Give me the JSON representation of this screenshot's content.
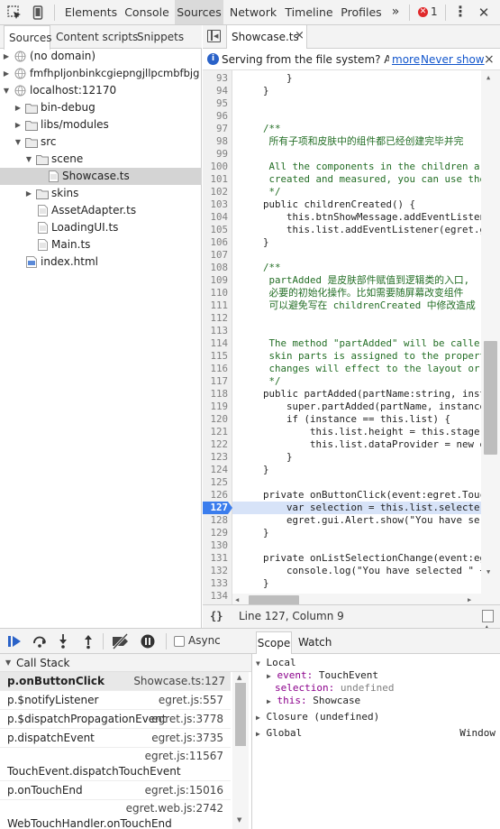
{
  "toolbar": {
    "tabs": [
      "Elements",
      "Console",
      "Sources",
      "Network",
      "Timeline",
      "Profiles"
    ],
    "active_tab": "Sources",
    "more": "»",
    "error_count": "1"
  },
  "navigator": {
    "tabs": [
      "Sources",
      "Content scripts",
      "Snippets"
    ],
    "tree": [
      {
        "label": "(no domain)"
      },
      {
        "label": "fmfhpljonbinkcgiepngjllpcmbfbjg"
      },
      {
        "label": "localhost:12170"
      },
      {
        "label": "bin-debug"
      },
      {
        "label": "libs/modules"
      },
      {
        "label": "src"
      },
      {
        "label": "scene"
      },
      {
        "label": "Showcase.ts"
      },
      {
        "label": "skins"
      },
      {
        "label": "AssetAdapter.ts"
      },
      {
        "label": "LoadingUI.ts"
      },
      {
        "label": "Main.ts"
      },
      {
        "label": "index.html"
      }
    ]
  },
  "editor": {
    "tab": "Showcase.ts",
    "tab_close": "×",
    "info": {
      "text": "Serving from the file system? Add y",
      "more": "more",
      "never_show": "Never show",
      "close": "×"
    },
    "lines": [
      {
        "n": "93",
        "t": "        }"
      },
      {
        "n": "94",
        "t": "    }"
      },
      {
        "n": "95",
        "t": ""
      },
      {
        "n": "96",
        "t": ""
      },
      {
        "n": "97",
        "t": "    /**"
      },
      {
        "n": "98",
        "t": "     所有子项和皮肤中的组件都已经创建完毕并完"
      },
      {
        "n": "99",
        "t": ""
      },
      {
        "n": "100",
        "t": "     All the components in the children ar"
      },
      {
        "n": "101",
        "t": "     created and measured, you can use the"
      },
      {
        "n": "102",
        "t": "     */"
      },
      {
        "n": "103",
        "t": "    public childrenCreated() {"
      },
      {
        "n": "104",
        "t": "        this.btnShowMessage.addEventListen"
      },
      {
        "n": "105",
        "t": "        this.list.addEventListener(egret.g"
      },
      {
        "n": "106",
        "t": "    }"
      },
      {
        "n": "107",
        "t": ""
      },
      {
        "n": "108",
        "t": "    /**"
      },
      {
        "n": "109",
        "t": "     partAdded 是皮肤部件赋值到逻辑类的入口,"
      },
      {
        "n": "110",
        "t": "     必要的初始化操作。比如需要随屏幕改变组件"
      },
      {
        "n": "111",
        "t": "     可以避免写在 childrenCreated 中修改造成"
      },
      {
        "n": "112",
        "t": ""
      },
      {
        "n": "113",
        "t": ""
      },
      {
        "n": "114",
        "t": "     The method \"partAdded\" will be calle"
      },
      {
        "n": "115",
        "t": "     skin parts is assigned to the propert"
      },
      {
        "n": "116",
        "t": "     changes will effect to the layout or"
      },
      {
        "n": "117",
        "t": "     */"
      },
      {
        "n": "118",
        "t": "    public partAdded(partName:string, inst"
      },
      {
        "n": "119",
        "t": "        super.partAdded(partName, instance"
      },
      {
        "n": "120",
        "t": "        if (instance == this.list) {"
      },
      {
        "n": "121",
        "t": "            this.list.height = this.stage"
      },
      {
        "n": "122",
        "t": "            this.list.dataProvider = new e"
      },
      {
        "n": "123",
        "t": "        }"
      },
      {
        "n": "124",
        "t": "    }"
      },
      {
        "n": "125",
        "t": ""
      },
      {
        "n": "126",
        "t": "    private onButtonClick(event:egret.Touc"
      },
      {
        "n": "127",
        "t": "        var selection = this.list.selecte"
      },
      {
        "n": "128",
        "t": "        egret.gui.Alert.show(\"You have se"
      },
      {
        "n": "129",
        "t": "    }"
      },
      {
        "n": "130",
        "t": ""
      },
      {
        "n": "131",
        "t": "    private onListSelectionChange(event:eg"
      },
      {
        "n": "132",
        "t": "        console.log(\"You have selected \" +"
      },
      {
        "n": "133",
        "t": "    }"
      },
      {
        "n": "134",
        "t": ""
      }
    ],
    "status": {
      "format_icon": "{}",
      "position": "Line 127, Column 9"
    }
  },
  "debugger": {
    "async_label": "Async",
    "callstack_title": "Call Stack",
    "frames": [
      {
        "name": "p.onButtonClick",
        "loc": "Showcase.ts:127"
      },
      {
        "name": "p.$notifyListener",
        "loc": "egret.js:557"
      },
      {
        "name": "p.$dispatchPropagationEvent",
        "loc": "egret.js:3778"
      },
      {
        "name": "p.dispatchEvent",
        "loc": "egret.js:3735"
      },
      {
        "name": "TouchEvent.dispatchTouchEvent",
        "loc": "egret.js:11567"
      },
      {
        "name": "p.onTouchEnd",
        "loc": "egret.js:15016"
      },
      {
        "name": "WebTouchHandler.onTouchEnd",
        "loc": "egret.web.js:2742"
      }
    ],
    "scope_tabs": [
      "Scope",
      "Watch"
    ],
    "scope": {
      "local_title": "Local",
      "event_key": "event:",
      "event_val": "TouchEvent",
      "selection_key": "selection:",
      "selection_val": "undefined",
      "this_key": "this:",
      "this_val": "Showcase",
      "closure": "Closure (undefined)",
      "global": "Global",
      "global_val": "Window"
    }
  }
}
